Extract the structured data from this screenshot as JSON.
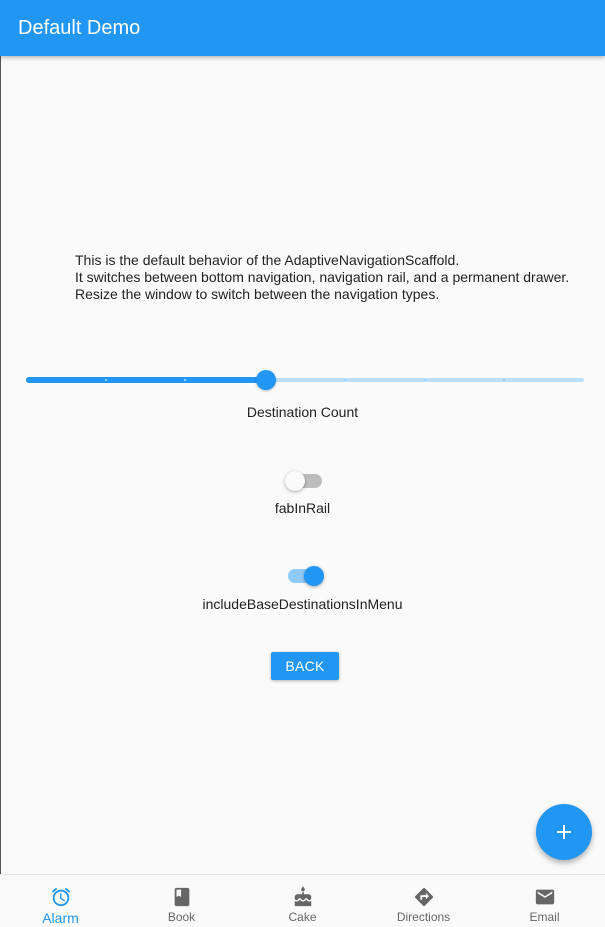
{
  "appbar": {
    "title": "Default Demo"
  },
  "description": {
    "lines": [
      "This is the default behavior of the AdaptiveNavigationScaffold.",
      "It switches between bottom navigation, navigation rail, and a permanent drawer.",
      "Resize the window to switch between the navigation types."
    ]
  },
  "slider": {
    "label": "Destination Count",
    "value_fraction": 0.43,
    "divisions": 7,
    "color": "#2196f3"
  },
  "switches": [
    {
      "label": "fabInRail",
      "on": false
    },
    {
      "label": "includeBaseDestinationsInMenu",
      "on": true
    }
  ],
  "back_button": {
    "label": "BACK"
  },
  "fab": {
    "icon": "add-icon"
  },
  "bottom_nav": {
    "items": [
      {
        "label": "Alarm",
        "icon": "alarm-icon",
        "active": true
      },
      {
        "label": "Book",
        "icon": "book-icon",
        "active": false
      },
      {
        "label": "Cake",
        "icon": "cake-icon",
        "active": false
      },
      {
        "label": "Directions",
        "icon": "directions-icon",
        "active": false
      },
      {
        "label": "Email",
        "icon": "email-icon",
        "active": false
      }
    ]
  },
  "colors": {
    "primary": "#2196f3",
    "inactive_icon": "#666666",
    "background": "#fafafa"
  }
}
